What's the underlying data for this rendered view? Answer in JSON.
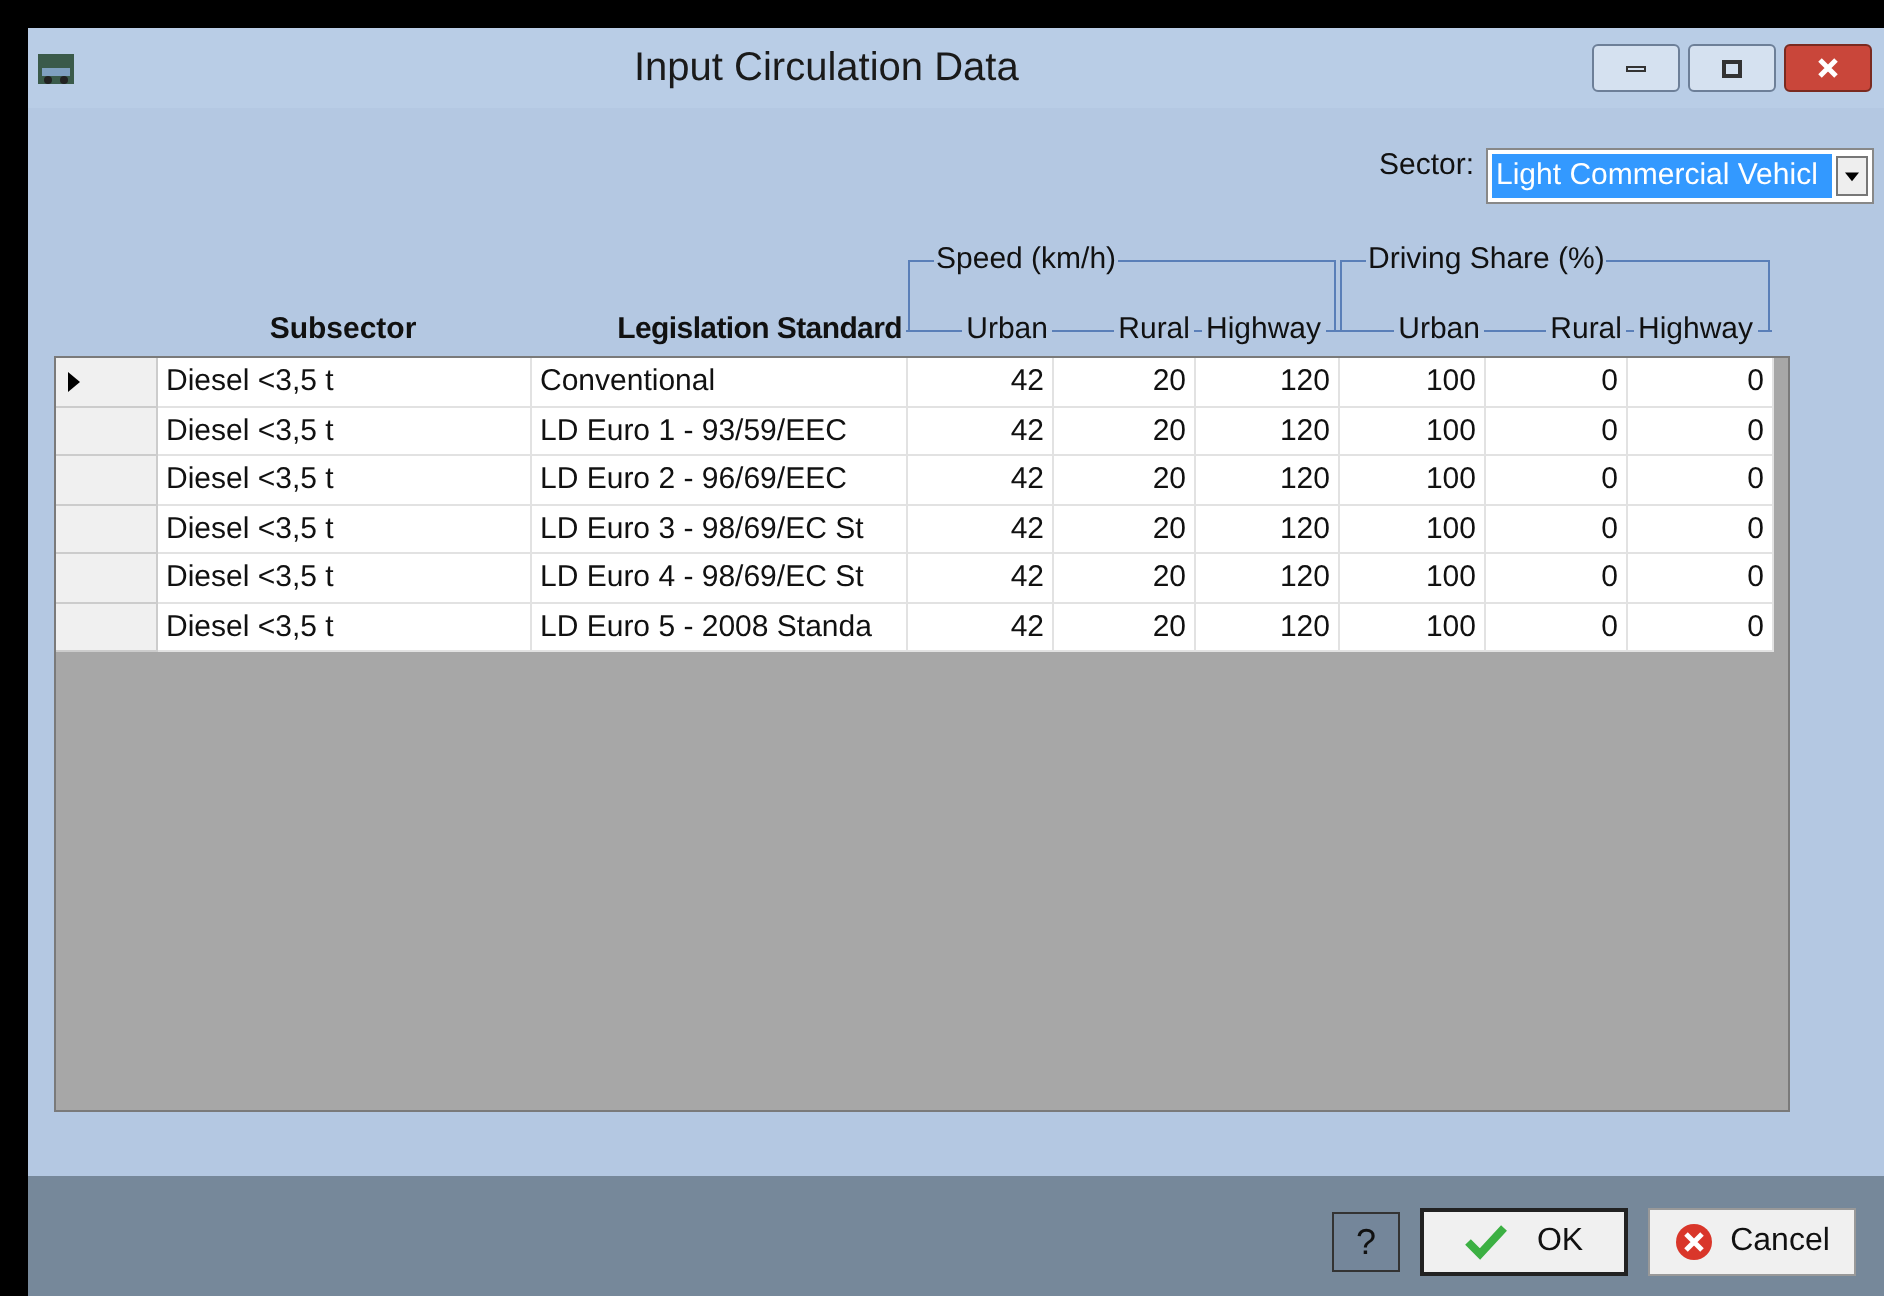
{
  "window": {
    "title": "Input Circulation Data"
  },
  "sector": {
    "label": "Sector:",
    "value": "Light Commercial Vehicl"
  },
  "columns": {
    "subsector": "Subsector",
    "legislation": "Legislation Standard"
  },
  "groups": [
    {
      "title": "Speed (km/h)",
      "columns": [
        "Urban",
        "Rural",
        "Highway"
      ]
    },
    {
      "title": "Driving Share (%)",
      "columns": [
        "Urban",
        "Rural",
        "Highway"
      ]
    }
  ],
  "rows": [
    {
      "selected": true,
      "subsector": "Diesel <3,5 t",
      "legislation": "Conventional",
      "values": [
        "42",
        "20",
        "120",
        "100",
        "0",
        "0"
      ]
    },
    {
      "selected": false,
      "subsector": "Diesel <3,5 t",
      "legislation": "LD Euro 1 - 93/59/EEC",
      "values": [
        "42",
        "20",
        "120",
        "100",
        "0",
        "0"
      ]
    },
    {
      "selected": false,
      "subsector": "Diesel <3,5 t",
      "legislation": "LD Euro 2 - 96/69/EEC",
      "values": [
        "42",
        "20",
        "120",
        "100",
        "0",
        "0"
      ]
    },
    {
      "selected": false,
      "subsector": "Diesel <3,5 t",
      "legislation": "LD Euro 3 - 98/69/EC St",
      "values": [
        "42",
        "20",
        "120",
        "100",
        "0",
        "0"
      ]
    },
    {
      "selected": false,
      "subsector": "Diesel <3,5 t",
      "legislation": "LD Euro 4 - 98/69/EC St",
      "values": [
        "42",
        "20",
        "120",
        "100",
        "0",
        "0"
      ]
    },
    {
      "selected": false,
      "subsector": "Diesel <3,5 t",
      "legislation": "LD Euro 5 - 2008 Standa",
      "values": [
        "42",
        "20",
        "120",
        "100",
        "0",
        "0"
      ]
    }
  ],
  "buttons": {
    "help": "?",
    "ok": "OK",
    "cancel": "Cancel"
  }
}
